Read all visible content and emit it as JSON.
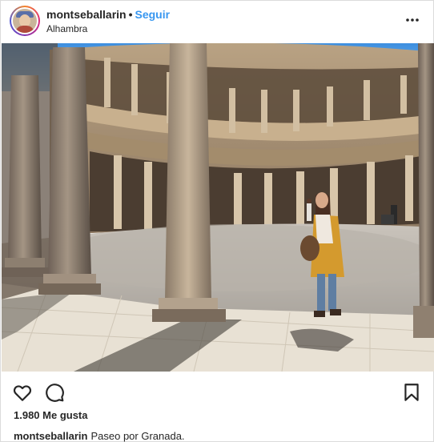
{
  "post": {
    "username": "montseballarin",
    "separator": "•",
    "follow_label": "Seguir",
    "location": "Alhambra",
    "more_label": "•••",
    "likes": "1.980 Me gusta",
    "caption_user": "montseballarin",
    "caption_text": "Paseo por Granada."
  },
  "colors": {
    "link": "#3897f0",
    "text": "#262626",
    "border": "#dbdbdb"
  },
  "icons": {
    "like": "heart-icon",
    "comment": "comment-bubble-icon",
    "save": "bookmark-icon",
    "more": "more-options-icon"
  }
}
